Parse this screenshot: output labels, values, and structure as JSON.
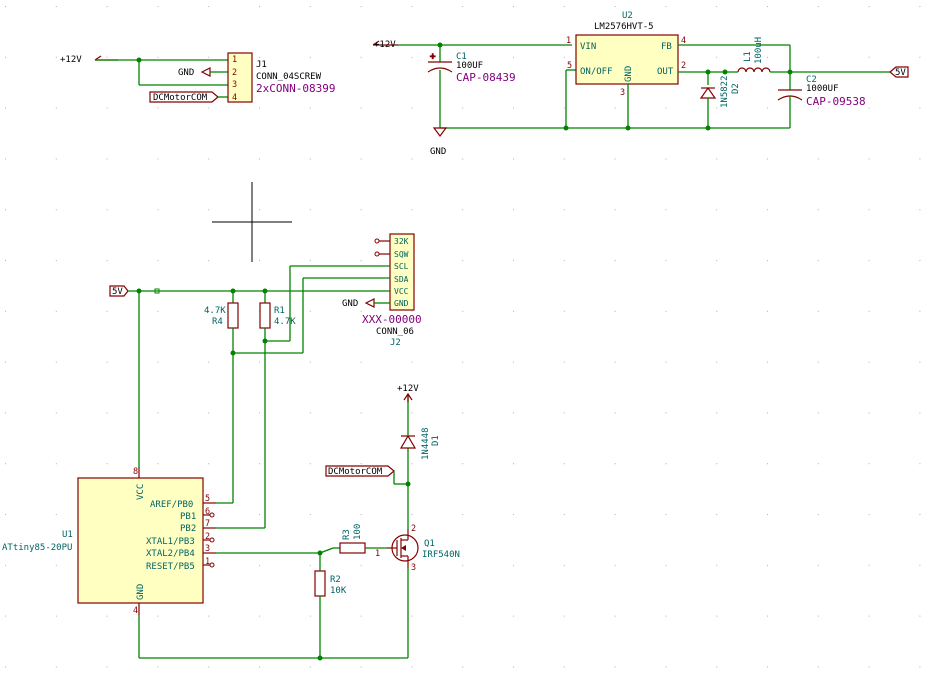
{
  "power": {
    "v12": "+12V",
    "gnd": "GND",
    "v5": "5V"
  },
  "labels": {
    "dcmotor": "DCMotorCOM"
  },
  "j1": {
    "ref": "J1",
    "value": "CONN_04SCREW",
    "part": "2xCONN-08399",
    "pins": [
      "1",
      "2",
      "3",
      "4"
    ]
  },
  "u2": {
    "ref": "U2",
    "value": "LM2576HVT-5",
    "pins": {
      "vin": "VIN",
      "onoff": "ON/OFF",
      "gnd": "GND",
      "fb": "FB",
      "out": "OUT"
    },
    "pinnums": {
      "vin": "1",
      "onoff": "5",
      "gnd": "3",
      "fb": "4",
      "out": "2"
    }
  },
  "c1": {
    "ref": "C1",
    "value": "100UF",
    "part": "CAP-08439"
  },
  "c2": {
    "ref": "C2",
    "value": "1000UF",
    "part": "CAP-09538"
  },
  "l1": {
    "ref": "L1",
    "value": "100uH"
  },
  "d2": {
    "ref": "D2",
    "value": "1N5822"
  },
  "j2": {
    "ref": "J2",
    "value": "CONN_06",
    "part": "XXX-00000",
    "pins": [
      "32K",
      "SQW",
      "SCL",
      "SDA",
      "VCC",
      "GND"
    ]
  },
  "r4": {
    "ref": "R4",
    "value": "4.7K"
  },
  "r1": {
    "ref": "R1",
    "value": "4.7K"
  },
  "r2": {
    "ref": "R2",
    "value": "10K"
  },
  "r3": {
    "ref": "R3",
    "value": "100"
  },
  "d1": {
    "ref": "D1",
    "value": "1N4448"
  },
  "q1": {
    "ref": "Q1",
    "value": "IRF540N",
    "pinnums": [
      "1",
      "2",
      "3"
    ]
  },
  "u1": {
    "ref": "U1",
    "value": "ATtiny85-20PU",
    "pins": [
      "VCC",
      "AREF/PB0",
      "PB1",
      "PB2",
      "XTAL1/PB3",
      "XTAL2/PB4",
      "RESET/PB5",
      "GND"
    ],
    "pinnums": [
      "8",
      "5",
      "6",
      "7",
      "2",
      "3",
      "1",
      "4"
    ]
  },
  "colors": {
    "wire": "#008400",
    "body": "#840000",
    "fill": "#ffffc2",
    "ref": "#006464",
    "part": "#84007c"
  }
}
